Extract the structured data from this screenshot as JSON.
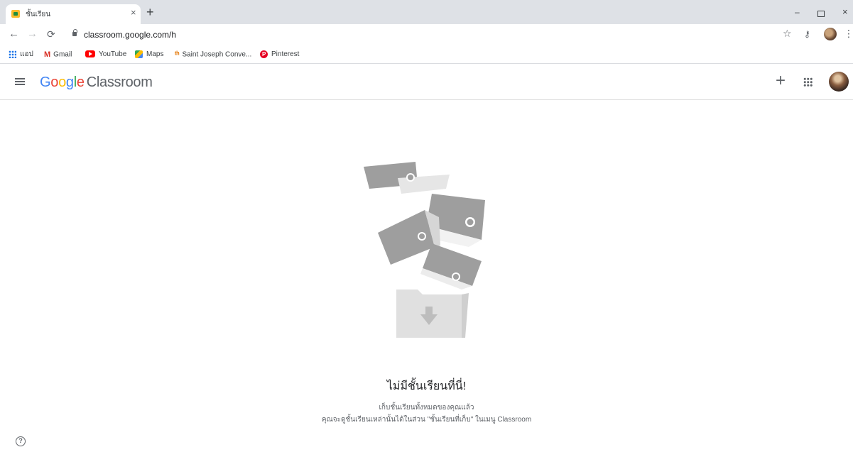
{
  "browser": {
    "tab_title": "ชั้นเรียน",
    "tab_close": "×",
    "new_tab": "+",
    "url": "classroom.google.com/h",
    "window_min": "–",
    "window_close": "×"
  },
  "bookmarks": [
    {
      "label": "แอป",
      "icon": "apps-grid-icon"
    },
    {
      "label": "Gmail",
      "icon": "gmail-icon"
    },
    {
      "label": "YouTube",
      "icon": "youtube-icon"
    },
    {
      "label": "Maps",
      "icon": "maps-icon"
    },
    {
      "label": "Saint Joseph Conve...",
      "icon": "school-icon"
    },
    {
      "label": "Pinterest",
      "icon": "pinterest-icon"
    }
  ],
  "header": {
    "logo_google": "Google",
    "logo_product": "Classroom",
    "add_label": "+"
  },
  "empty_state": {
    "title": "ไม่มีชั้นเรียนที่นี่!",
    "line1": "เก็บชั้นเรียนทั้งหมดของคุณแล้ว",
    "line2": "คุณจะดูชั้นเรียนเหล่านั้นได้ในส่วน \"ชั้นเรียนที่เก็บ\" ในเมนู Classroom"
  },
  "help": "?",
  "colors": {
    "google_blue": "#4285f4",
    "google_red": "#ea4335",
    "google_yellow": "#fbbc04",
    "google_green": "#34a853",
    "illustration_gray": "#9e9e9e"
  }
}
